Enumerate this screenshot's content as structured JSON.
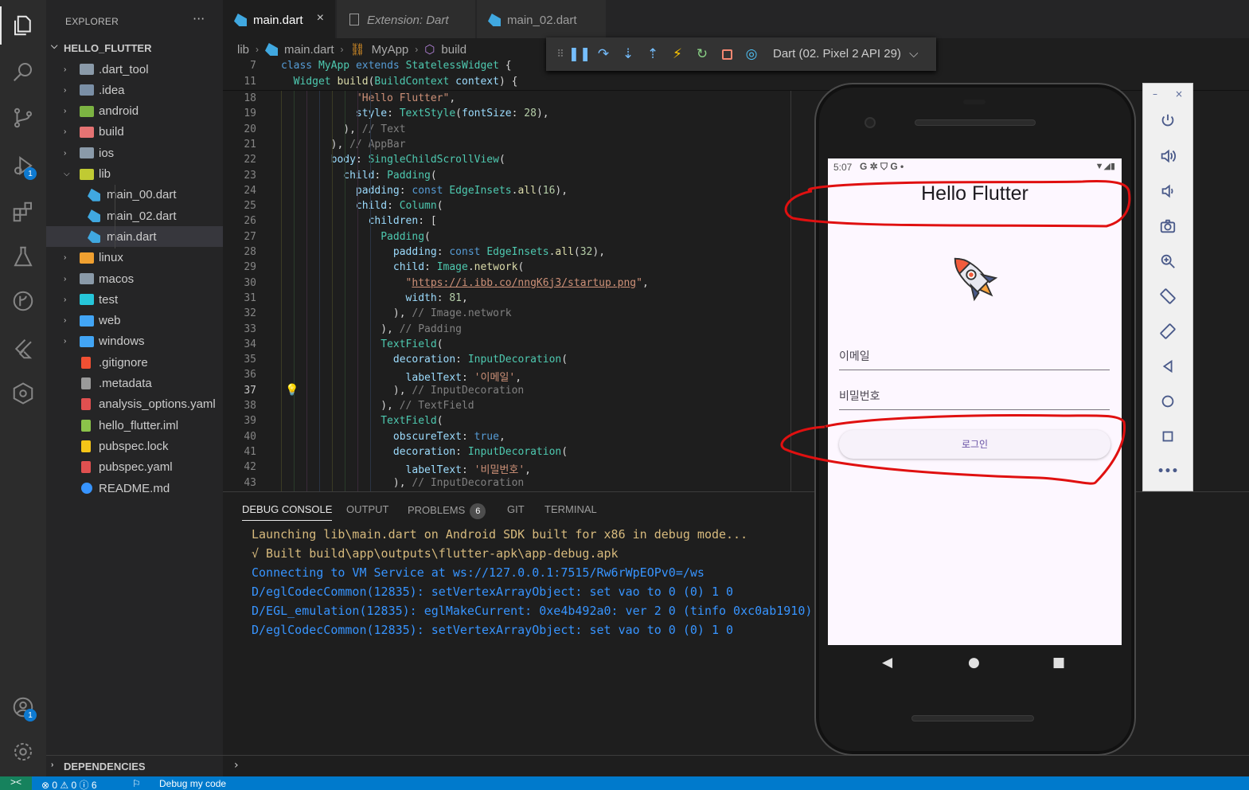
{
  "activity": {
    "explorer": "files-icon",
    "search": "search-icon",
    "scm": "source-control-icon",
    "debug": "run-debug-icon",
    "debug_badge": "1",
    "extensions": "extensions-icon",
    "testing": "beaker-icon",
    "timeline": "git-graph-icon",
    "flutter": "flutter-icon",
    "kubernetes": "helm-icon",
    "accounts": "account-icon",
    "accounts_badge": "1",
    "settings": "gear-icon"
  },
  "sidebar": {
    "title": "EXPLORER",
    "more": "···",
    "project": "HELLO_FLUTTER",
    "items": [
      {
        "label": ".dart_tool",
        "type": "folder",
        "color": "#8a9aa9"
      },
      {
        "label": ".idea",
        "type": "folder",
        "color": "#7a8fa6"
      },
      {
        "label": "android",
        "type": "folder",
        "color": "#7cb342"
      },
      {
        "label": "build",
        "type": "folder",
        "color": "#e57373"
      },
      {
        "label": "ios",
        "type": "folder",
        "color": "#8a9aa9"
      },
      {
        "label": "lib",
        "type": "folder-open",
        "color": "#c0ca33"
      },
      {
        "label": "main_00.dart",
        "type": "dart"
      },
      {
        "label": "main_02.dart",
        "type": "dart"
      },
      {
        "label": "main.dart",
        "type": "dart"
      },
      {
        "label": "linux",
        "type": "folder",
        "color": "#f0a030"
      },
      {
        "label": "macos",
        "type": "folder",
        "color": "#8a9aa9"
      },
      {
        "label": "test",
        "type": "folder",
        "color": "#26c6da"
      },
      {
        "label": "web",
        "type": "folder",
        "color": "#42a5f5"
      },
      {
        "label": "windows",
        "type": "folder",
        "color": "#42a5f5"
      },
      {
        "label": ".gitignore",
        "type": "git"
      },
      {
        "label": ".metadata",
        "type": "file"
      },
      {
        "label": "analysis_options.yaml",
        "type": "yaml"
      },
      {
        "label": "hello_flutter.iml",
        "type": "iml"
      },
      {
        "label": "pubspec.lock",
        "type": "lock"
      },
      {
        "label": "pubspec.yaml",
        "type": "yaml"
      },
      {
        "label": "README.md",
        "type": "info"
      }
    ],
    "dependencies": "DEPENDENCIES"
  },
  "tabs": [
    {
      "label": "main.dart",
      "close": "×"
    },
    {
      "label": "Extension: Dart"
    },
    {
      "label": "main_02.dart"
    }
  ],
  "breadcrumb": [
    "lib",
    "main.dart",
    "MyApp",
    "build"
  ],
  "debug_toolbar": {
    "target": "Dart (02. Pixel 2 API 29)",
    "buttons": [
      "drag-handle-icon",
      "pause-icon",
      "step-over-icon",
      "step-into-icon",
      "step-out-icon",
      "hot-reload-icon",
      "restart-icon",
      "stop-icon",
      "devtools-icon"
    ]
  },
  "editor": {
    "sticky": [
      {
        "n": "7",
        "code": "class MyApp extends StatelessWidget {"
      },
      {
        "n": "11",
        "code": "  Widget build(BuildContext context) {"
      }
    ],
    "lines": [
      {
        "n": "18",
        "indent": "            ",
        "parts": [
          [
            "s",
            "\"Hello Flutter\""
          ],
          [
            "",
            ","
          ]
        ]
      },
      {
        "n": "19",
        "indent": "            ",
        "parts": [
          [
            "pr",
            "style"
          ],
          [
            "",
            ": "
          ],
          [
            "c",
            "TextStyle"
          ],
          [
            "",
            "("
          ],
          [
            "pr",
            "fontSize"
          ],
          [
            "",
            ": "
          ],
          [
            "n",
            "28"
          ],
          [
            "",
            "),"
          ]
        ]
      },
      {
        "n": "20",
        "indent": "          ",
        "parts": [
          [
            "",
            "), "
          ],
          [
            "dim",
            "// Text"
          ]
        ]
      },
      {
        "n": "21",
        "indent": "        ",
        "parts": [
          [
            "",
            "), "
          ],
          [
            "dim",
            "// AppBar"
          ]
        ]
      },
      {
        "n": "22",
        "indent": "        ",
        "parts": [
          [
            "pr",
            "body"
          ],
          [
            "",
            ": "
          ],
          [
            "c",
            "SingleChildScrollView"
          ],
          [
            "",
            "("
          ]
        ]
      },
      {
        "n": "23",
        "indent": "          ",
        "parts": [
          [
            "pr",
            "child"
          ],
          [
            "",
            ": "
          ],
          [
            "c",
            "Padding"
          ],
          [
            "",
            "("
          ]
        ]
      },
      {
        "n": "24",
        "indent": "            ",
        "parts": [
          [
            "pr",
            "padding"
          ],
          [
            "",
            ": "
          ],
          [
            "k",
            "const"
          ],
          [
            "",
            " "
          ],
          [
            "c",
            "EdgeInsets"
          ],
          [
            "",
            "."
          ],
          [
            "f",
            "all"
          ],
          [
            "",
            "("
          ],
          [
            "n",
            "16"
          ],
          [
            "",
            "),"
          ]
        ]
      },
      {
        "n": "25",
        "indent": "            ",
        "parts": [
          [
            "pr",
            "child"
          ],
          [
            "",
            ": "
          ],
          [
            "c",
            "Column"
          ],
          [
            "",
            "("
          ]
        ]
      },
      {
        "n": "26",
        "indent": "              ",
        "parts": [
          [
            "pr",
            "children"
          ],
          [
            "",
            ": ["
          ]
        ]
      },
      {
        "n": "27",
        "indent": "                ",
        "parts": [
          [
            "c",
            "Padding"
          ],
          [
            "",
            "("
          ]
        ]
      },
      {
        "n": "28",
        "indent": "                  ",
        "parts": [
          [
            "pr",
            "padding"
          ],
          [
            "",
            ": "
          ],
          [
            "k",
            "const"
          ],
          [
            "",
            " "
          ],
          [
            "c",
            "EdgeInsets"
          ],
          [
            "",
            "."
          ],
          [
            "f",
            "all"
          ],
          [
            "",
            "("
          ],
          [
            "n",
            "32"
          ],
          [
            "",
            "),"
          ]
        ]
      },
      {
        "n": "29",
        "indent": "                  ",
        "parts": [
          [
            "pr",
            "child"
          ],
          [
            "",
            ": "
          ],
          [
            "c",
            "Image"
          ],
          [
            "",
            "."
          ],
          [
            "f",
            "network"
          ],
          [
            "",
            "("
          ]
        ]
      },
      {
        "n": "30",
        "indent": "                    ",
        "parts": [
          [
            "s",
            "\""
          ],
          [
            "su",
            "https://i.ibb.co/nngK6j3/startup.png"
          ],
          [
            "s",
            "\""
          ],
          [
            "",
            ","
          ]
        ]
      },
      {
        "n": "31",
        "indent": "                    ",
        "parts": [
          [
            "pr",
            "width"
          ],
          [
            "",
            ": "
          ],
          [
            "n",
            "81"
          ],
          [
            "",
            ","
          ]
        ]
      },
      {
        "n": "32",
        "indent": "                  ",
        "parts": [
          [
            "",
            "), "
          ],
          [
            "dim",
            "// Image.network"
          ]
        ]
      },
      {
        "n": "33",
        "indent": "                ",
        "parts": [
          [
            "",
            "), "
          ],
          [
            "dim",
            "// Padding"
          ]
        ]
      },
      {
        "n": "34",
        "indent": "                ",
        "parts": [
          [
            "c",
            "TextField"
          ],
          [
            "",
            "("
          ]
        ]
      },
      {
        "n": "35",
        "indent": "                  ",
        "parts": [
          [
            "pr",
            "decoration"
          ],
          [
            "",
            ": "
          ],
          [
            "c",
            "InputDecoration"
          ],
          [
            "",
            "("
          ]
        ]
      },
      {
        "n": "36",
        "indent": "                    ",
        "parts": [
          [
            "pr",
            "labelText"
          ],
          [
            "",
            ": "
          ],
          [
            "s",
            "'이메일'"
          ],
          [
            "",
            ","
          ]
        ]
      },
      {
        "n": "37",
        "indent": "                  ",
        "parts": [
          [
            "",
            "), "
          ],
          [
            "dim",
            "// InputDecoration"
          ]
        ]
      },
      {
        "n": "38",
        "indent": "                ",
        "parts": [
          [
            "",
            "), "
          ],
          [
            "dim",
            "// TextField"
          ]
        ]
      },
      {
        "n": "39",
        "indent": "                ",
        "parts": [
          [
            "c",
            "TextField"
          ],
          [
            "",
            "("
          ]
        ]
      },
      {
        "n": "40",
        "indent": "                  ",
        "parts": [
          [
            "pr",
            "obscureText"
          ],
          [
            "",
            ": "
          ],
          [
            "k",
            "true"
          ],
          [
            "",
            ","
          ]
        ]
      },
      {
        "n": "41",
        "indent": "                  ",
        "parts": [
          [
            "pr",
            "decoration"
          ],
          [
            "",
            ": "
          ],
          [
            "c",
            "InputDecoration"
          ],
          [
            "",
            "("
          ]
        ]
      },
      {
        "n": "42",
        "indent": "                    ",
        "parts": [
          [
            "pr",
            "labelText"
          ],
          [
            "",
            ": "
          ],
          [
            "s",
            "'비밀번호'"
          ],
          [
            "",
            ","
          ]
        ]
      },
      {
        "n": "43",
        "indent": "                  ",
        "parts": [
          [
            "",
            "), "
          ],
          [
            "dim",
            "// InputDecoration"
          ]
        ]
      }
    ],
    "current_line": "37"
  },
  "panel": {
    "tabs": [
      "DEBUG CONSOLE",
      "OUTPUT",
      "PROBLEMS",
      "GIT",
      "TERMINAL"
    ],
    "problems_count": "6",
    "console": [
      {
        "text": "Launching lib\\main.dart on Android SDK built for x86 in debug mode...",
        "tone": "cy"
      },
      {
        "text": "√ Built build\\app\\outputs\\flutter-apk\\app-debug.apk",
        "tone": "cy"
      },
      {
        "text": "Connecting to VM Service at ws://127.0.0.1:7515/Rw6rWpEOPv0=/ws",
        "tone": "cb"
      },
      {
        "text": "D/eglCodecCommon(12835): setVertexArrayObject: set vao to 0 (0) 1 0",
        "tone": "cb"
      },
      {
        "text": "D/EGL_emulation(12835): eglMakeCurrent: 0xe4b492a0: ver 2 0 (tinfo 0xc0ab1910)",
        "tone": "cb"
      },
      {
        "text": "D/eglCodecCommon(12835): setVertexArrayObject: set vao to 0 (0) 1 0",
        "tone": "cb"
      }
    ]
  },
  "status": {
    "remote": "><",
    "problems": "⊗ 0 ⚠ 0 ⓘ 6",
    "debug": "Debug my code"
  },
  "phone": {
    "time": "5:07",
    "status_icons": "G ✲ ⛉ G •",
    "app_title": "Hello Flutter",
    "email_label": "이메일",
    "password_label": "비밀번호",
    "login_button": "로그인",
    "nav": [
      "◀",
      "●",
      "■"
    ]
  },
  "emulator_tools": {
    "window": [
      "–",
      "×"
    ],
    "buttons": [
      "power-icon",
      "volume-up-icon",
      "volume-down-icon",
      "camera-icon",
      "zoom-icon",
      "rotate-left-icon",
      "rotate-right-icon",
      "back-icon",
      "home-icon",
      "overview-icon",
      "more-icon"
    ],
    "more": "•••"
  }
}
